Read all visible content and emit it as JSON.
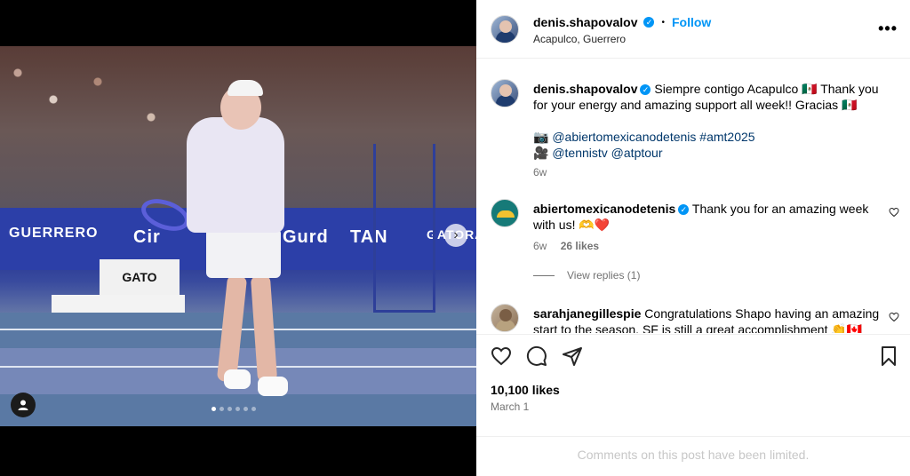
{
  "post": {
    "username": "denis.shapovalov",
    "follow_label": "Follow",
    "separator": "•",
    "location": "Acapulco, Guerrero",
    "more_label": "•••"
  },
  "media": {
    "banner_texts": [
      "GUERRERO",
      "Cir",
      "Gurd",
      "TAN",
      "GATORA"
    ],
    "ad_text": "GATO",
    "slide_count": 6,
    "active_slide": 0,
    "next_glyph": "›"
  },
  "caption": {
    "username": "denis.shapovalov",
    "text": "Siempre contigo Acapulco 🇲🇽 Thank you for your energy and amazing support all week!! Gracias 🇲🇽",
    "line1_prefix": "📷",
    "line1_links": "@abiertomexicanodetenis #amt2025",
    "line2_prefix": "🎥",
    "line2_links": "@tennistv @atptour",
    "time": "6w"
  },
  "comments": [
    {
      "username": "abiertomexicanodetenis",
      "text": "Thank you for an amazing week with us! 🫶❤️",
      "time": "6w",
      "likes": "26 likes",
      "view_replies": "View replies (1)"
    },
    {
      "username": "sarahjanegillespie",
      "text": "Congratulations Shapo having an amazing start to the season. SF is still a great accomplishment 👏🇨🇦"
    }
  ],
  "actions": {
    "likes": "10,100 likes",
    "date": "March 1",
    "limited": "Comments on this post have been limited."
  },
  "icons": {
    "like": "heart-icon",
    "comment": "comment-icon",
    "share": "share-icon",
    "save": "bookmark-icon",
    "verified": "verified-badge-icon",
    "user_tag": "user-tag-icon"
  },
  "colors": {
    "accent": "#0095f6",
    "link": "#00376b",
    "muted": "#737373"
  }
}
